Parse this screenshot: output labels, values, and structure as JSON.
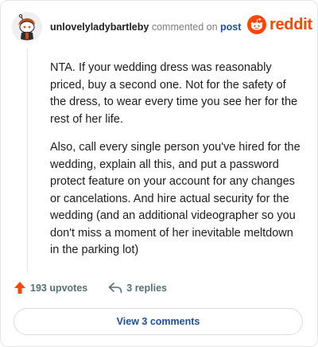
{
  "comment": {
    "username": "unlovelyladybartleby",
    "verb": "commented on",
    "target": "post",
    "paragraphs": [
      "NTA. If your wedding dress was reasonably priced, buy a second one. Not for the safety of the dress, to wear every time you see her for the rest of her life.",
      "Also, call every single person you've hired for the wedding, explain all this, and put a password protect feature on your account for any changes or cancelations. And hire actual security for the wedding (and an additional videographer so you don't miss a moment of her inevitable meltdown in the parking lot)"
    ]
  },
  "brand": {
    "name": "reddit",
    "color": "#ff4500"
  },
  "stats": {
    "upvotes_label": "193 upvotes",
    "replies_label": "3 replies"
  },
  "footer": {
    "view_comments_label": "View 3 comments"
  },
  "icons": {
    "avatar": "snoo-avatar-icon",
    "logo": "reddit-logo-icon",
    "upvote": "upvote-arrow-icon",
    "reply": "reply-arrow-icon"
  },
  "colors": {
    "accent": "#ff4500",
    "link": "#1f4fa0",
    "muted": "#576f76"
  }
}
